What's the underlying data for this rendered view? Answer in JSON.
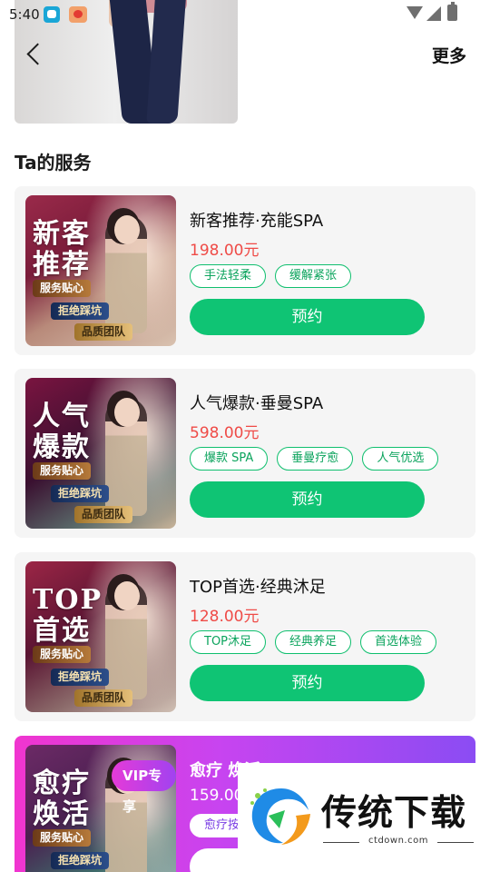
{
  "status_bar": {
    "time": "5:40"
  },
  "nav": {
    "more_label": "更多"
  },
  "section_title": "Ta的服务",
  "services": [
    {
      "image_title": "新客推荐",
      "image_badges": [
        "服务贴心",
        "拒绝踩坑",
        "品质团队"
      ],
      "name": "新客推荐·充能SPA",
      "price": "198.00元",
      "tags": [
        "手法轻柔",
        "缓解紧张"
      ],
      "button": "预约"
    },
    {
      "image_title": "人气爆款",
      "image_badges": [
        "服务贴心",
        "拒绝踩坑",
        "品质团队"
      ],
      "name": "人气爆款·垂曼SPA",
      "price": "598.00元",
      "tags": [
        "爆款 SPA",
        "垂曼疗愈",
        "人气优选"
      ],
      "button": "预约"
    },
    {
      "image_title": "TOP首选",
      "image_badges": [
        "服务贴心",
        "拒绝踩坑",
        "品质团队"
      ],
      "name": "TOP首选·经典沐足",
      "price": "128.00元",
      "tags": [
        "TOP沐足",
        "经典养足",
        "首选体验"
      ],
      "button": "预约"
    },
    {
      "image_title": "愈疗焕活",
      "image_badges": [
        "服务贴心",
        "拒绝踩坑"
      ],
      "vip_badge": "VIP专享",
      "name": "愈疗 焕活",
      "price": "159.00",
      "tags": [
        "愈疗按"
      ]
    }
  ],
  "watermark": {
    "title": "传统下载",
    "url": "ctdown.com"
  },
  "colors": {
    "accent_green": "#0fc474",
    "price_red": "#ef4b47",
    "vip_gradient_start": "#f035cf",
    "vip_gradient_end": "#8b4cf3"
  }
}
